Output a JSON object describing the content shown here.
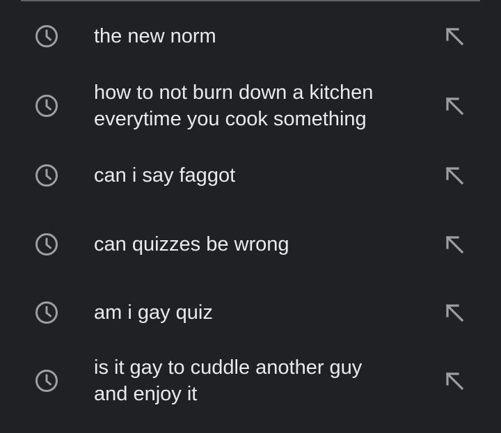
{
  "history": {
    "items": [
      {
        "label": "the new norm",
        "icon": "history-clock-icon",
        "action_icon": "insert-arrow-icon"
      },
      {
        "label": "how to not burn down a kitchen\neverytime you cook something",
        "icon": "history-clock-icon",
        "action_icon": "insert-arrow-icon"
      },
      {
        "label": "can i say faggot",
        "icon": "history-clock-icon",
        "action_icon": "insert-arrow-icon"
      },
      {
        "label": "can quizzes be wrong",
        "icon": "history-clock-icon",
        "action_icon": "insert-arrow-icon"
      },
      {
        "label": "am i gay quiz",
        "icon": "history-clock-icon",
        "action_icon": "insert-arrow-icon"
      },
      {
        "label": "is it gay to cuddle another guy\nand enjoy it",
        "icon": "history-clock-icon",
        "action_icon": "insert-arrow-icon"
      }
    ]
  },
  "colors": {
    "background": "#202124",
    "text": "#e8eaed",
    "icon": "#9aa0a6",
    "divider": "#5f6368"
  }
}
